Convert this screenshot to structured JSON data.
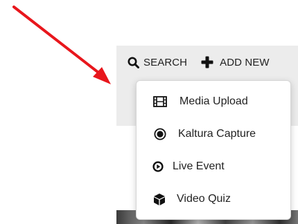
{
  "toolbar": {
    "search_label": "SEARCH",
    "add_new_label": "ADD NEW"
  },
  "add_new_menu": {
    "items": [
      {
        "label": "Media Upload",
        "icon": "film-icon"
      },
      {
        "label": "Kaltura Capture",
        "icon": "record-icon"
      },
      {
        "label": "Live Event",
        "icon": "play-circle-icon"
      },
      {
        "label": "Video Quiz",
        "icon": "cube-icon"
      }
    ]
  },
  "annotation": {
    "arrow_color": "#e8161c"
  }
}
